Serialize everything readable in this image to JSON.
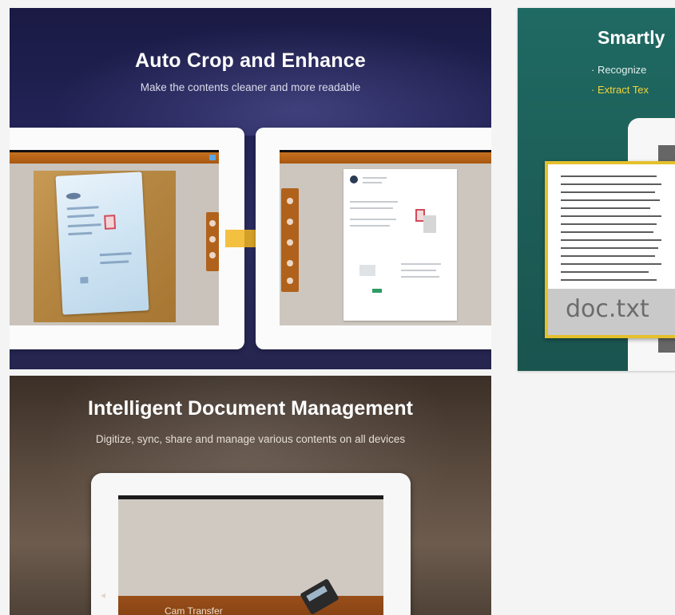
{
  "card1": {
    "title": "Auto Crop and Enhance",
    "subtitle": "Make the contents cleaner and more readable"
  },
  "card2": {
    "title": "Intelligent Document Management",
    "subtitle": "Digitize, sync, share and manage various contents on all devices",
    "screen_caption": "Cam Transfer"
  },
  "card3": {
    "title": "Smartly",
    "bullet1": "· Recognize",
    "bullet2": "· Extract Tex",
    "file_name": "doc.txt"
  },
  "colors": {
    "card1_bg": "#232357",
    "card2_bg": "#5a4a3e",
    "card3_bg": "#1f6a63",
    "accent_orange": "#b0621c",
    "arrow": "#f2b51f",
    "highlight_yellow": "#e4c02b"
  },
  "icons": [
    "arrow-right-icon",
    "scanner-icon",
    "chevron-left-icon"
  ]
}
